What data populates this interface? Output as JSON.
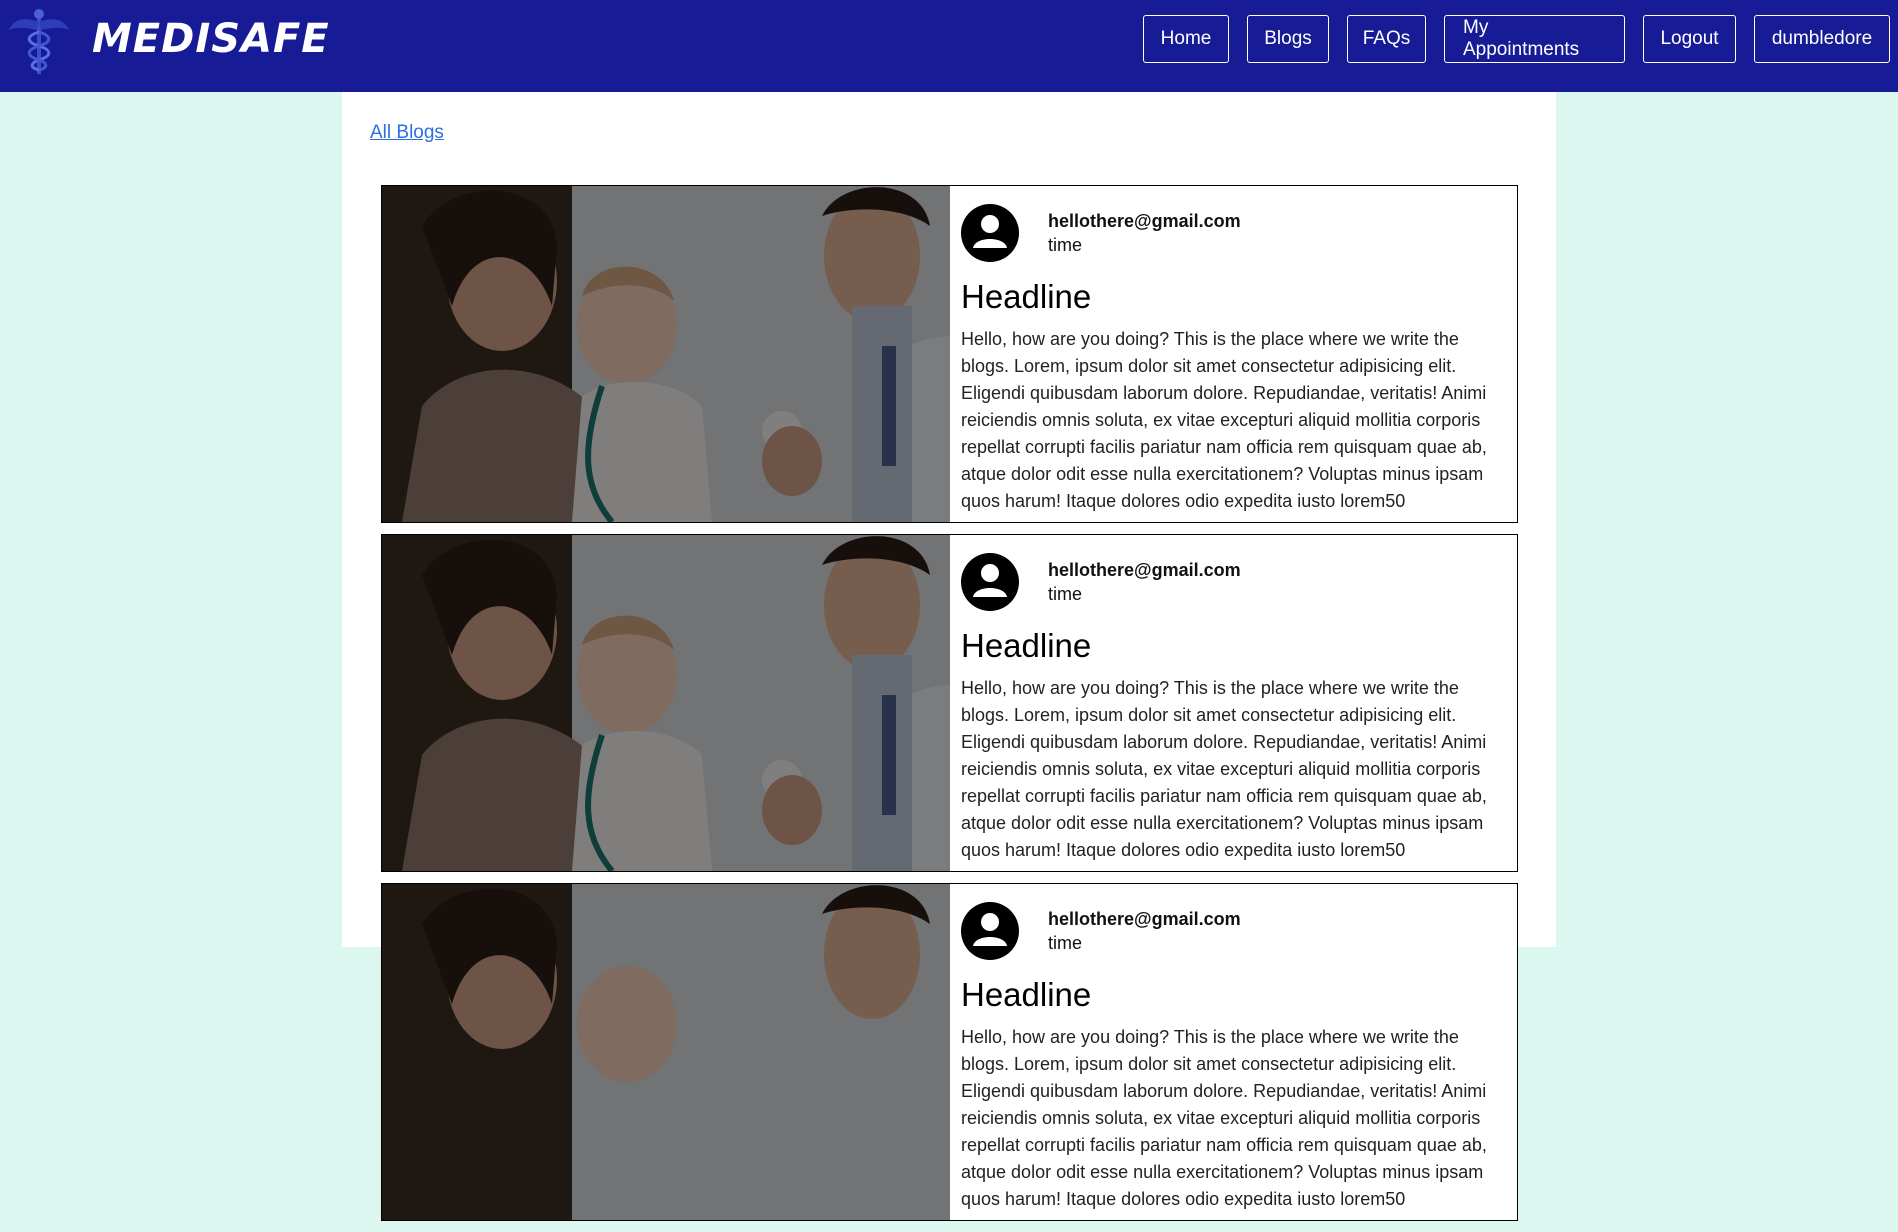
{
  "navbar": {
    "brand": "MEDISAFE",
    "logo_icon": "caduceus-icon",
    "links": [
      {
        "label": "Home"
      },
      {
        "label": "Blogs"
      },
      {
        "label": "FAQs"
      },
      {
        "label": "My Appointments"
      },
      {
        "label": "Logout"
      },
      {
        "label": "dumbledore"
      }
    ],
    "colors": {
      "background": "#171b96",
      "text": "#ffffff"
    }
  },
  "page": {
    "back_link": "All Blogs",
    "background": "#dbf7ef"
  },
  "blogs": [
    {
      "email": "hellothere@gmail.com",
      "time": "time",
      "headline": "Headline",
      "body": "Hello, how are you doing? This is the place where we write the blogs. Lorem, ipsum dolor sit amet consectetur adipisicing elit. Eligendi quibusdam laborum dolore. Repudiandae, veritatis! Animi reiciendis omnis soluta, ex vitae excepturi aliquid mollitia corporis repellat corrupti facilis pariatur nam officia rem quisquam quae ab, atque dolor odit esse nulla exercitationem? Voluptas minus ipsam quos harum! Itaque dolores odio expedita iusto lorem50",
      "image": "doctor-mother-baby-photo"
    },
    {
      "email": "hellothere@gmail.com",
      "time": "time",
      "headline": "Headline",
      "body": "Hello, how are you doing? This is the place where we write the blogs. Lorem, ipsum dolor sit amet consectetur adipisicing elit. Eligendi quibusdam laborum dolore. Repudiandae, veritatis! Animi reiciendis omnis soluta, ex vitae excepturi aliquid mollitia corporis repellat corrupti facilis pariatur nam officia rem quisquam quae ab, atque dolor odit esse nulla exercitationem? Voluptas minus ipsam quos harum! Itaque dolores odio expedita iusto lorem50",
      "image": "doctor-mother-baby-photo"
    },
    {
      "email": "hellothere@gmail.com",
      "time": "time",
      "headline": "Headline",
      "body": "Hello, how are you doing? This is the place where we write the blogs. Lorem, ipsum dolor sit amet consectetur adipisicing elit. Eligendi quibusdam laborum dolore. Repudiandae, veritatis! Animi reiciendis omnis soluta, ex vitae excepturi aliquid mollitia corporis repellat corrupti facilis pariatur nam officia rem quisquam quae ab, atque dolor odit esse nulla exercitationem? Voluptas minus ipsam quos harum! Itaque dolores odio expedita iusto lorem50",
      "image": "doctor-mother-baby-photo"
    }
  ]
}
